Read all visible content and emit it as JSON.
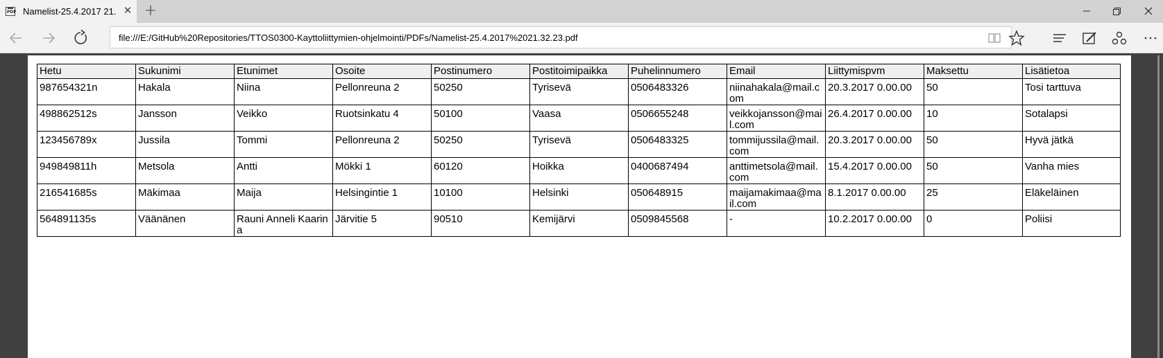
{
  "tab": {
    "title": "Namelist-25.4.2017 21.32.23.pdf",
    "favicon_label": "PDF"
  },
  "address": {
    "url": "file:///E:/GitHub%20Repositories/TTOS0300-Kayttoliittymien-ohjelmointi/PDFs/Namelist-25.4.2017%2021.32.23.pdf"
  },
  "table": {
    "headers": [
      "Hetu",
      "Sukunimi",
      "Etunimet",
      "Osoite",
      "Postinumero",
      "Postitoimipaikka",
      "Puhelinnumero",
      "Email",
      "Liittymispvm",
      "Maksettu",
      "Lisätietoa"
    ],
    "rows": [
      [
        "987654321n",
        "Hakala",
        "Niina",
        "Pellonreuna 2",
        "50250",
        "Tyrisevä",
        "0506483326",
        "niinahakala@mail.com",
        "20.3.2017 0.00.00",
        "50",
        "Tosi tarttuva"
      ],
      [
        "498862512s",
        "Jansson",
        "Veikko",
        "Ruotsinkatu 4",
        "50100",
        "Vaasa",
        "0506655248",
        "veikkojansson@mail.com",
        "26.4.2017 0.00.00",
        "10",
        "Sotalapsi"
      ],
      [
        "123456789x",
        "Jussila",
        "Tommi",
        "Pellonreuna 2",
        "50250",
        "Tyrisevä",
        "0506483325",
        "tommijussila@mail.com",
        "20.3.2017 0.00.00",
        "50",
        "Hyvä jätkä"
      ],
      [
        "949849811h",
        "Metsola",
        "Antti",
        "Mökki 1",
        "60120",
        "Hoikka",
        "0400687494",
        "anttimetsola@mail.com",
        "15.4.2017 0.00.00",
        "50",
        "Vanha mies"
      ],
      [
        "216541685s",
        "Mäkimaa",
        "Maija",
        "Helsingintie 1",
        "10100",
        "Helsinki",
        "050648915",
        "maijamakimaa@mail.com",
        "8.1.2017 0.00.00",
        "25",
        "Eläkeläinen"
      ],
      [
        "564891135s",
        "Väänänen",
        "Rauni Anneli Kaarina",
        "Järvitie 5",
        "90510",
        "Kemijärvi",
        "0509845568",
        "-",
        "10.2.2017 0.00.00",
        "0",
        "Poliisi"
      ]
    ]
  }
}
